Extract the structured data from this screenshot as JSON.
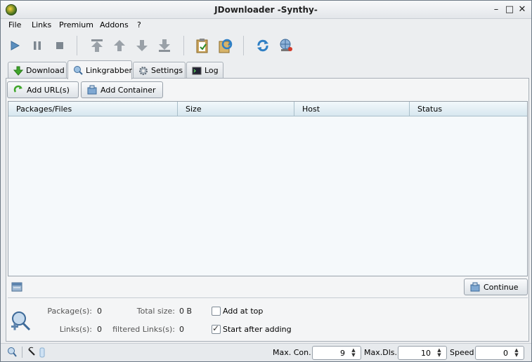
{
  "window": {
    "title": "JDownloader -Synthy-"
  },
  "menu": [
    "File",
    "Links",
    "Premium",
    "Addons",
    "?"
  ],
  "toolbar": {
    "icons": [
      "play-icon",
      "pause-icon",
      "stop-icon",
      "move-top-icon",
      "move-up-icon",
      "move-down-icon",
      "move-bottom-icon",
      "clipboard-icon",
      "reconnect-icon",
      "update-icon",
      "network-icon"
    ]
  },
  "tabs": [
    {
      "label": "Download",
      "active": false
    },
    {
      "label": "Linkgrabber",
      "active": true
    },
    {
      "label": "Settings",
      "active": false
    },
    {
      "label": "Log",
      "active": false
    }
  ],
  "linkgrabber": {
    "add_urls_label": "Add URL(s)",
    "add_container_label": "Add Container",
    "columns": [
      "Packages/Files",
      "Size",
      "Host",
      "Status"
    ],
    "rows": [],
    "continue_label": "Continue"
  },
  "info": {
    "packages_label": "Package(s):",
    "packages_value": "0",
    "total_size_label": "Total size:",
    "total_size_value": "0 B",
    "links_label": "Links(s):",
    "links_value": "0",
    "filtered_label": "filtered Links(s):",
    "filtered_value": "0",
    "add_at_top_label": "Add at top",
    "add_at_top_checked": false,
    "start_after_label": "Start after adding",
    "start_after_checked": true
  },
  "statusbar": {
    "max_con_label": "Max. Con.",
    "max_con_value": "9",
    "max_dls_label": "Max.Dls.",
    "max_dls_value": "10",
    "speed_label": "Speed",
    "speed_value": "0"
  },
  "colors": {
    "accent": "#3a82c4",
    "table_bg": "#f5f9fb",
    "header_bg": "#d7e7ef"
  }
}
